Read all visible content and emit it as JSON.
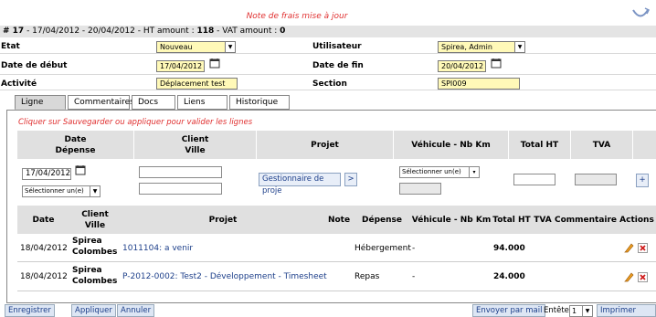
{
  "banner": "Note de frais mise à jour",
  "record": {
    "prefix": "# 17",
    "rest": " - 17/04/2012 - 20/04/2012 - HT amount : ",
    "ht": "118",
    "vat_label": " - VAT amount : ",
    "vat": "0"
  },
  "form": {
    "etat_label": "Etat",
    "etat_value": "Nouveau",
    "user_label": "Utilisateur",
    "user_value": "Spirea, Admin",
    "start_label": "Date de début",
    "start_value": "17/04/2012",
    "end_label": "Date de fin",
    "end_value": "20/04/2012",
    "activity_label": "Activité",
    "activity_value": "Déplacement test",
    "section_label": "Section",
    "section_value": "SPI009"
  },
  "tabs": [
    "Ligne",
    "Commentaires",
    "Docs",
    "Liens",
    "Historique"
  ],
  "hint": "Cliquer sur Sauvegarder ou appliquer pour valider les lignes",
  "entry": {
    "headers": {
      "date": "Date",
      "depense": "Dépense",
      "client": "Client",
      "ville": "Ville",
      "projet": "Projet",
      "vehicule": "Véhicule - Nb Km",
      "total": "Total HT",
      "tva": "TVA"
    },
    "date_value": "17/04/2012",
    "select_placeholder": "Sélectionner un(e)",
    "project_button": "Gestionnaire de proje",
    "go_button": ">",
    "vehicle_placeholder": "Sélectionner un(e)",
    "add_button": "+"
  },
  "table": {
    "headers": {
      "date": "Date",
      "client": "Client",
      "ville": "Ville",
      "projet": "Projet",
      "note": "Note",
      "depense": "Dépense",
      "vehicule": "Véhicule - Nb Km",
      "total": "Total HT",
      "tva": "TVA",
      "commentaire": "Commentaire",
      "actions": "Actions"
    },
    "rows": [
      {
        "date": "18/04/2012",
        "client": "Spirea",
        "ville": "Colombes",
        "projet": "1011104: a venir",
        "note": "",
        "depense": "Hébergement",
        "vehicule": "-",
        "total": "94.000"
      },
      {
        "date": "18/04/2012",
        "client": "Spirea",
        "ville": "Colombes",
        "projet": "P-2012-0002: Test2 - Développement - Timesheet",
        "note": "",
        "depense": "Repas",
        "vehicule": "-",
        "total": "24.000"
      }
    ]
  },
  "footer": {
    "save": "Enregistrer",
    "apply": "Appliquer",
    "cancel": "Annuler",
    "mail": "Envoyer par mail",
    "header_label": "Entête",
    "header_value": "1",
    "pdf": "Imprimer PDF"
  }
}
